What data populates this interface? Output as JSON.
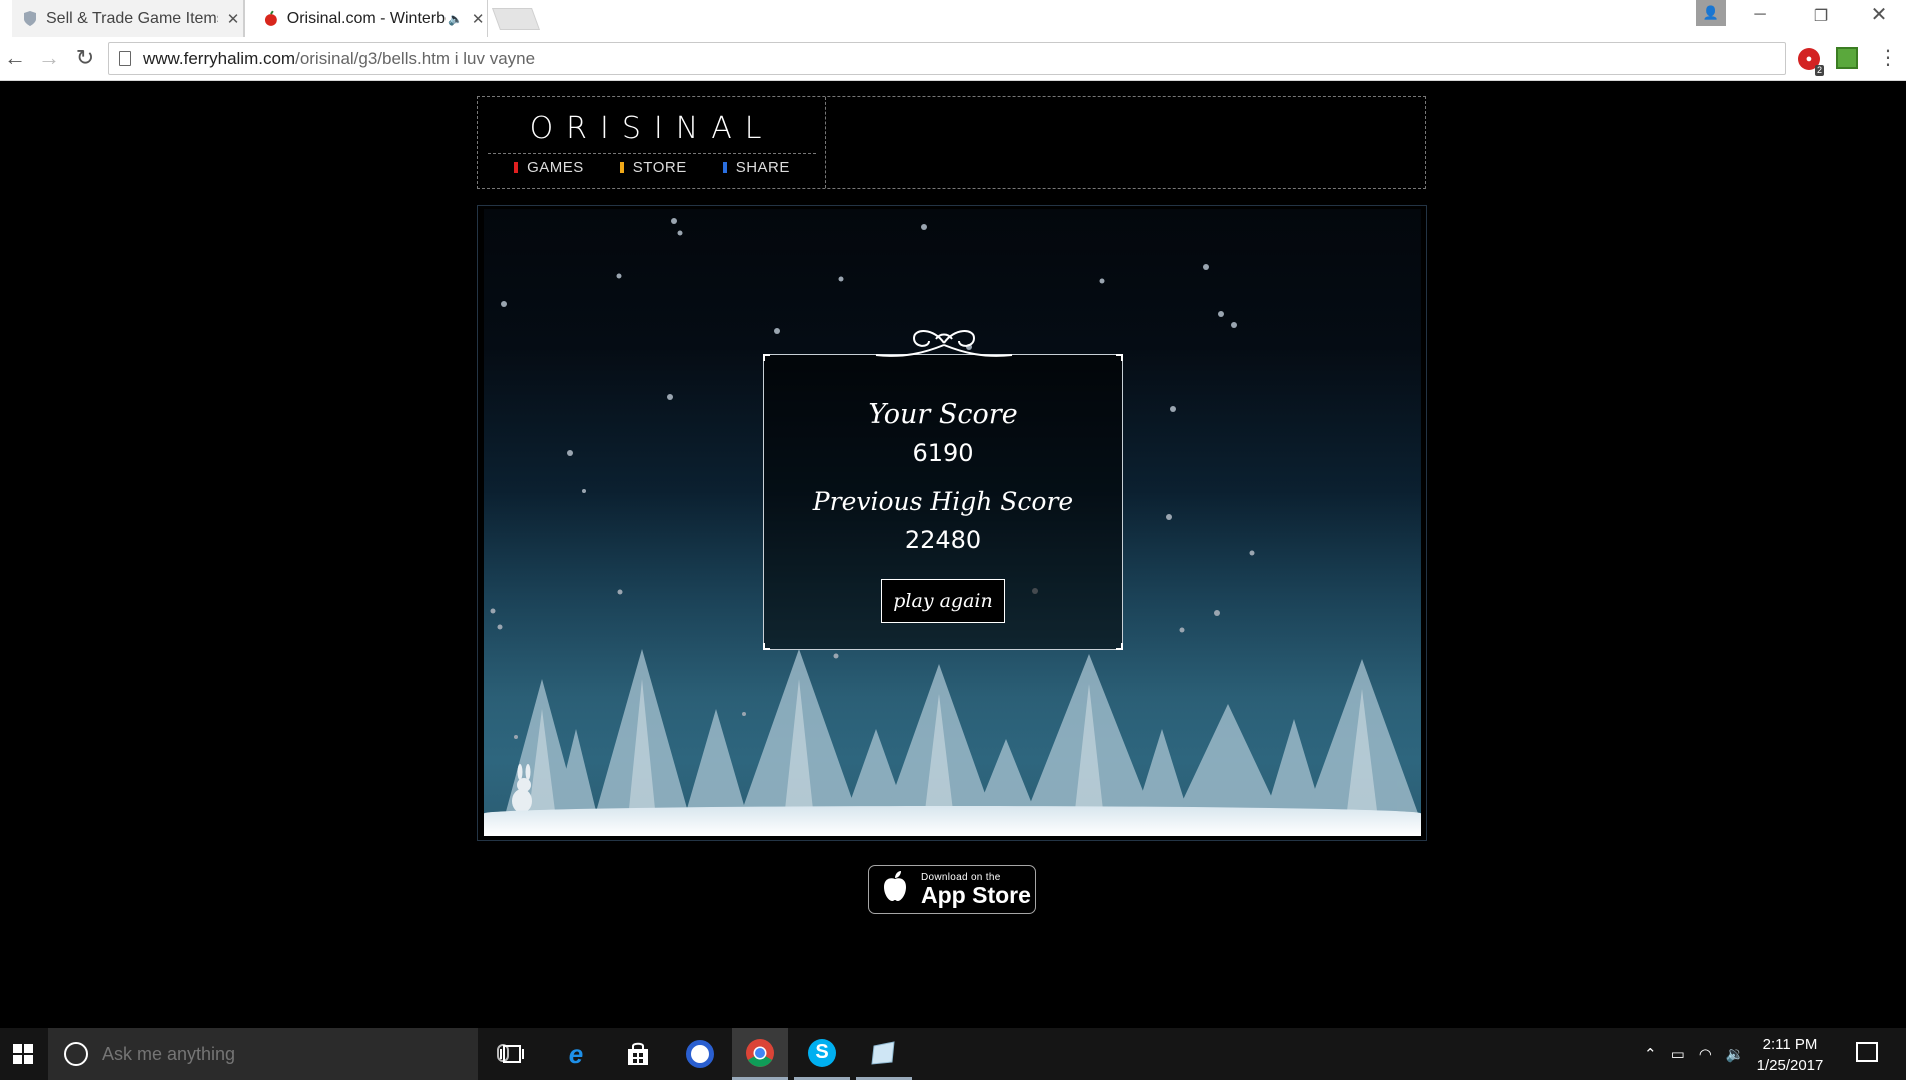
{
  "browser": {
    "tabs": [
      {
        "title": "Sell & Trade Game Items",
        "icon": "shield-icon",
        "active": false
      },
      {
        "title": "Orisinal.com - Winterbells",
        "icon": "apple-icon",
        "active": true,
        "audio": true
      }
    ],
    "url_host": "www.ferryhalim.com",
    "url_path": "/orisinal/g3/bells.htm i luv vayne",
    "extension_badge": "2"
  },
  "site": {
    "logo": "ORISINAL",
    "nav": [
      {
        "label": "GAMES",
        "color": "#e02020"
      },
      {
        "label": "STORE",
        "color": "#f0a818"
      },
      {
        "label": "SHARE",
        "color": "#2a6fe0"
      }
    ]
  },
  "game": {
    "your_score_label": "Your Score",
    "your_score": "6190",
    "prev_score_label": "Previous High Score",
    "prev_score": "22480",
    "play_again": "play again"
  },
  "appstore": {
    "small": "Download on the",
    "big": "App Store"
  },
  "taskbar": {
    "search_placeholder": "Ask me anything",
    "time": "2:11 PM",
    "date": "1/25/2017"
  }
}
